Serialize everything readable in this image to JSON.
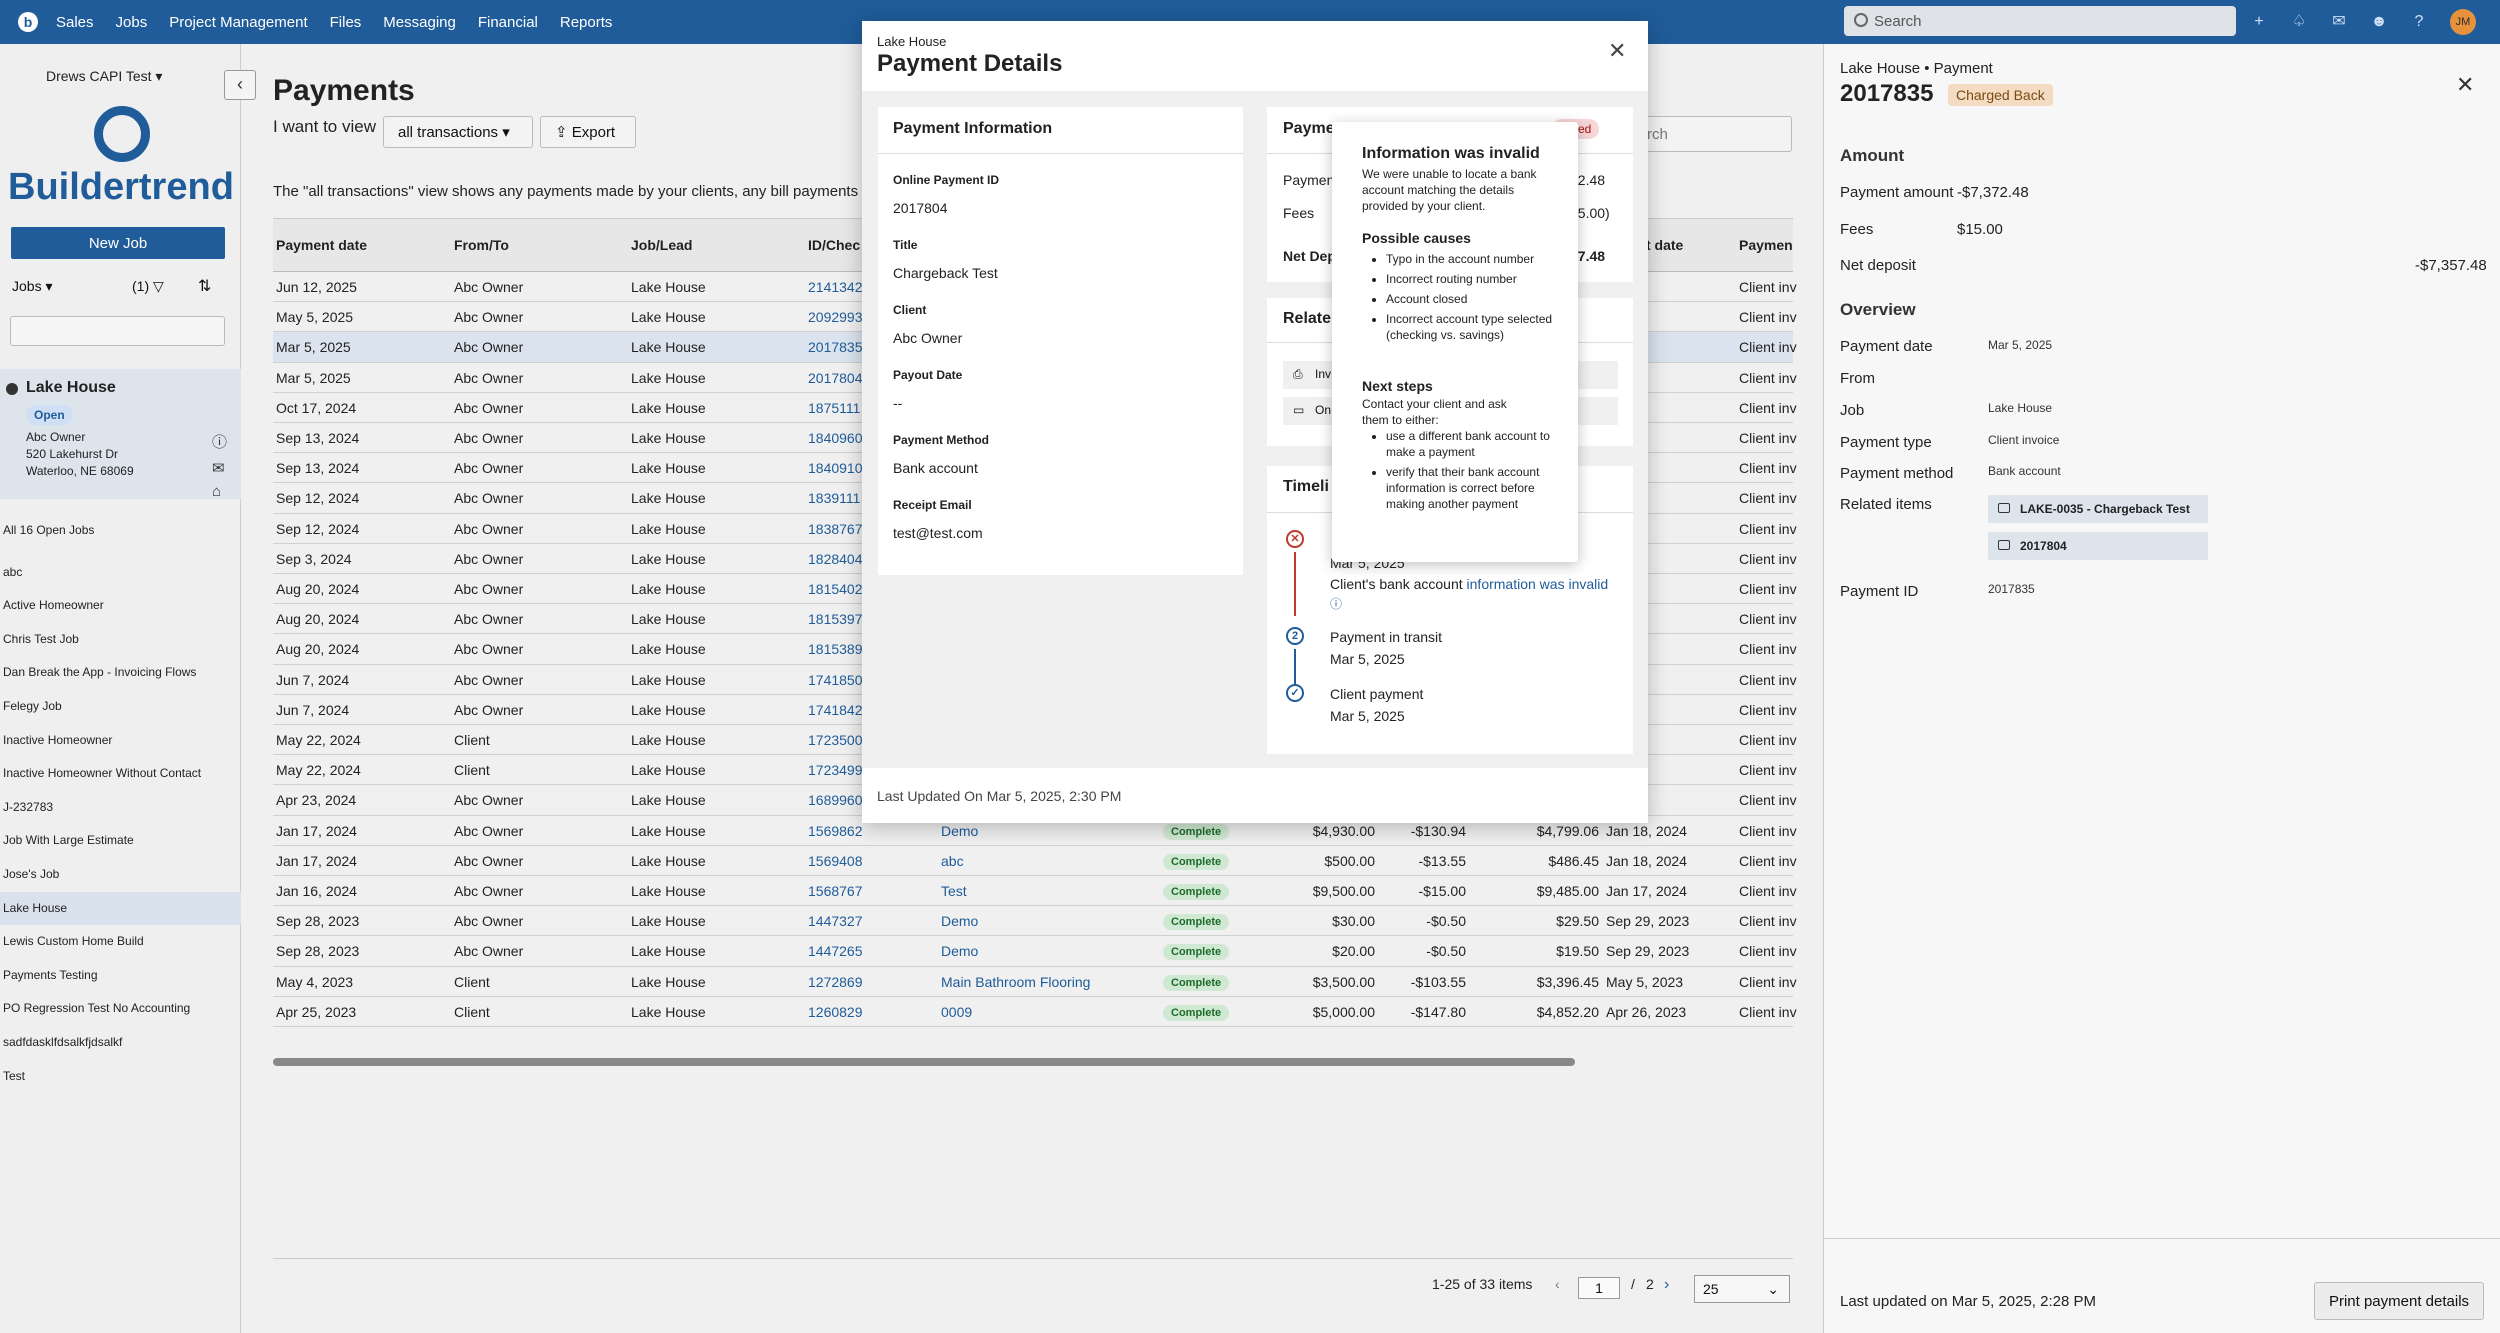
{
  "topnav": {
    "logo": "b",
    "items": [
      "Sales",
      "Jobs",
      "Project Management",
      "Files",
      "Messaging",
      "Financial",
      "Reports"
    ],
    "search_placeholder": "Search",
    "avatar_initials": "JM"
  },
  "sidebar": {
    "account": "Drews CAPI Test",
    "brand": "Buildertrend",
    "new_job": "New Job",
    "jobs_dropdown": "Jobs",
    "filter_count": "(1)",
    "job": {
      "name": "Lake House",
      "status": "Open",
      "owner": "Abc Owner",
      "address1": "520 Lakehurst Dr",
      "address2": "Waterloo, NE 68069"
    },
    "all_jobs": "All 16 Open Jobs",
    "jobs": [
      "abc",
      "Active Homeowner",
      "Chris Test Job",
      "Dan Break the App - Invoicing Flows",
      "Felegy Job",
      "Inactive Homeowner",
      "Inactive Homeowner Without Contact",
      "J-232783",
      "Job With Large Estimate",
      "Jose's Job",
      "Lake House",
      "Lewis Custom Home Build",
      "Payments Testing",
      "PO Regression Test No Accounting",
      "sadfdasklfdsalkfjdsalkf",
      "Test"
    ]
  },
  "main": {
    "title": "Payments",
    "i_want": "I want to view",
    "view_select": "all transactions",
    "export": "Export",
    "description": "The \"all transactions\" view shows any payments made by your clients, any bill payments m",
    "search_placeholder": "rch",
    "columns": [
      "Payment date",
      "From/To",
      "Job/Lead",
      "ID/Chec",
      "Payment date2",
      "Paymen"
    ],
    "col_deposit_date": "t date",
    "rows": [
      {
        "date": "Jun 12, 2025",
        "from": "Abc Owner",
        "job": "Lake House",
        "id": "2141342",
        "type": "Client inv"
      },
      {
        "date": "May 5, 2025",
        "from": "Abc Owner",
        "job": "Lake House",
        "id": "2092993",
        "type": "Client inv"
      },
      {
        "date": "Mar 5, 2025",
        "from": "Abc Owner",
        "job": "Lake House",
        "id": "2017835",
        "type": "Client inv"
      },
      {
        "date": "Mar 5, 2025",
        "from": "Abc Owner",
        "job": "Lake House",
        "id": "2017804",
        "type": "Client inv"
      },
      {
        "date": "Oct 17, 2024",
        "from": "Abc Owner",
        "job": "Lake House",
        "id": "1875111",
        "type": "Client inv"
      },
      {
        "date": "Sep 13, 2024",
        "from": "Abc Owner",
        "job": "Lake House",
        "id": "1840960",
        "type": "Client inv"
      },
      {
        "date": "Sep 13, 2024",
        "from": "Abc Owner",
        "job": "Lake House",
        "id": "1840910",
        "type": "Client inv"
      },
      {
        "date": "Sep 12, 2024",
        "from": "Abc Owner",
        "job": "Lake House",
        "id": "1839111",
        "type": "Client inv"
      },
      {
        "date": "Sep 12, 2024",
        "from": "Abc Owner",
        "job": "Lake House",
        "id": "1838767",
        "type": "Client inv"
      },
      {
        "date": "Sep 3, 2024",
        "from": "Abc Owner",
        "job": "Lake House",
        "id": "1828404",
        "type": "Client inv"
      },
      {
        "date": "Aug 20, 2024",
        "from": "Abc Owner",
        "job": "Lake House",
        "id": "1815402",
        "type": "Client inv"
      },
      {
        "date": "Aug 20, 2024",
        "from": "Abc Owner",
        "job": "Lake House",
        "id": "1815397",
        "type": "Client inv"
      },
      {
        "date": "Aug 20, 2024",
        "from": "Abc Owner",
        "job": "Lake House",
        "id": "1815389",
        "type": "Client inv"
      },
      {
        "date": "Jun 7, 2024",
        "from": "Abc Owner",
        "job": "Lake House",
        "id": "1741850",
        "type": "Client inv"
      },
      {
        "date": "Jun 7, 2024",
        "from": "Abc Owner",
        "job": "Lake House",
        "id": "1741842",
        "type": "Client inv"
      },
      {
        "date": "May 22, 2024",
        "from": "Client",
        "job": "Lake House",
        "id": "1723500",
        "type": "Client inv"
      },
      {
        "date": "May 22, 2024",
        "from": "Client",
        "job": "Lake House",
        "id": "1723499",
        "type": "Client inv"
      },
      {
        "date": "Apr 23, 2024",
        "from": "Abc Owner",
        "job": "Lake House",
        "id": "1689960",
        "type": "Client inv"
      }
    ],
    "full_rows": [
      {
        "date": "Jan 17, 2024",
        "from": "Abc Owner",
        "job": "Lake House",
        "id": "1569862",
        "title": "Demo",
        "status": "Complete",
        "amount": "$4,930.00",
        "fee": "-$130.94",
        "net": "$4,799.06",
        "deposit": "Jan 18, 2024",
        "type": "Client inv"
      },
      {
        "date": "Jan 17, 2024",
        "from": "Abc Owner",
        "job": "Lake House",
        "id": "1569408",
        "title": "abc",
        "status": "Complete",
        "amount": "$500.00",
        "fee": "-$13.55",
        "net": "$486.45",
        "deposit": "Jan 18, 2024",
        "type": "Client inv"
      },
      {
        "date": "Jan 16, 2024",
        "from": "Abc Owner",
        "job": "Lake House",
        "id": "1568767",
        "title": "Test",
        "status": "Complete",
        "amount": "$9,500.00",
        "fee": "-$15.00",
        "net": "$9,485.00",
        "deposit": "Jan 17, 2024",
        "type": "Client inv"
      },
      {
        "date": "Sep 28, 2023",
        "from": "Abc Owner",
        "job": "Lake House",
        "id": "1447327",
        "title": "Demo",
        "status": "Complete",
        "amount": "$30.00",
        "fee": "-$0.50",
        "net": "$29.50",
        "deposit": "Sep 29, 2023",
        "type": "Client inv"
      },
      {
        "date": "Sep 28, 2023",
        "from": "Abc Owner",
        "job": "Lake House",
        "id": "1447265",
        "title": "Demo",
        "status": "Complete",
        "amount": "$20.00",
        "fee": "-$0.50",
        "net": "$19.50",
        "deposit": "Sep 29, 2023",
        "type": "Client inv"
      },
      {
        "date": "May 4, 2023",
        "from": "Client",
        "job": "Lake House",
        "id": "1272869",
        "title": "Main Bathroom Flooring",
        "status": "Complete",
        "amount": "$3,500.00",
        "fee": "-$103.55",
        "net": "$3,396.45",
        "deposit": "May 5, 2023",
        "type": "Client inv"
      },
      {
        "date": "Apr 25, 2023",
        "from": "Client",
        "job": "Lake House",
        "id": "1260829",
        "title": "0009",
        "status": "Complete",
        "amount": "$5,000.00",
        "fee": "-$147.80",
        "net": "$4,852.20",
        "deposit": "Apr 26, 2023",
        "type": "Client inv"
      }
    ],
    "pager": {
      "range": "1-25 of 33 items",
      "page": "1",
      "sep": "/",
      "total": "2",
      "page_size": "25"
    }
  },
  "right_panel": {
    "subtitle": "Lake House • Payment",
    "id": "2017835",
    "badge": "Charged Back",
    "amount_h": "Amount",
    "payment_amount_l": "Payment amount",
    "payment_amount_v": "-$7,372.48",
    "fees_l": "Fees",
    "fees_v": "$15.00",
    "net_l": "Net deposit",
    "net_v": "-$7,357.48",
    "overview_h": "Overview",
    "payment_date_l": "Payment date",
    "payment_date_v": "Mar 5, 2025",
    "from_l": "From",
    "job_l": "Job",
    "job_v": "Lake House",
    "type_l": "Payment type",
    "type_v": "Client invoice",
    "method_l": "Payment method",
    "method_v": "Bank account",
    "related_l": "Related items",
    "related": [
      "LAKE-0035 - Chargeback Test",
      "2017804"
    ],
    "pid_l": "Payment ID",
    "pid_v": "2017835",
    "updated": "Last updated on Mar 5, 2025, 2:28 PM",
    "print": "Print payment details"
  },
  "modal": {
    "subtitle": "Lake House",
    "title": "Payment Details",
    "info_h": "Payment Information",
    "fields": [
      {
        "label": "Online Payment ID",
        "value": "2017804"
      },
      {
        "label": "Title",
        "value": "Chargeback Test"
      },
      {
        "label": "Client",
        "value": "Abc Owner"
      },
      {
        "label": "Payout Date",
        "value": "--"
      },
      {
        "label": "Payment Method",
        "value": "Bank account"
      },
      {
        "label": "Receipt Email",
        "value": "test@test.com"
      }
    ],
    "amount_h": "Payment Amou",
    "declined": "clined",
    "amount_rows": [
      {
        "label": "Payment",
        "value": "72.48"
      },
      {
        "label": "Fees",
        "value": "15.00)"
      },
      {
        "label": "Net Dep",
        "value": "57.48"
      }
    ],
    "related_h": "Relate",
    "related": [
      "Inv",
      "On"
    ],
    "timeline_h": "Timeli",
    "timeline": [
      {
        "date": "Mar 5, 2025",
        "text": "Client's bank account ",
        "link": "information was invalid"
      },
      {
        "title": "Payment in transit",
        "date": "Mar 5, 2025"
      },
      {
        "title": "Client payment",
        "date": "Mar 5, 2025"
      }
    ],
    "footer": "Last Updated On Mar 5, 2025, 2:30 PM"
  },
  "popover": {
    "title": "Information was invalid",
    "intro": "We were unable to locate a bank account matching the details provided by your client.",
    "causes_h": "Possible causes",
    "causes": [
      "Typo in the account number",
      "Incorrect routing number",
      "Account closed",
      "Incorrect account type selected (checking vs. savings)"
    ],
    "next_h": "Next steps",
    "next_intro": "Contact your client and ask them to either:",
    "next": [
      "use a different bank account to make a payment",
      "verify that their bank account information is correct before making another payment"
    ]
  }
}
